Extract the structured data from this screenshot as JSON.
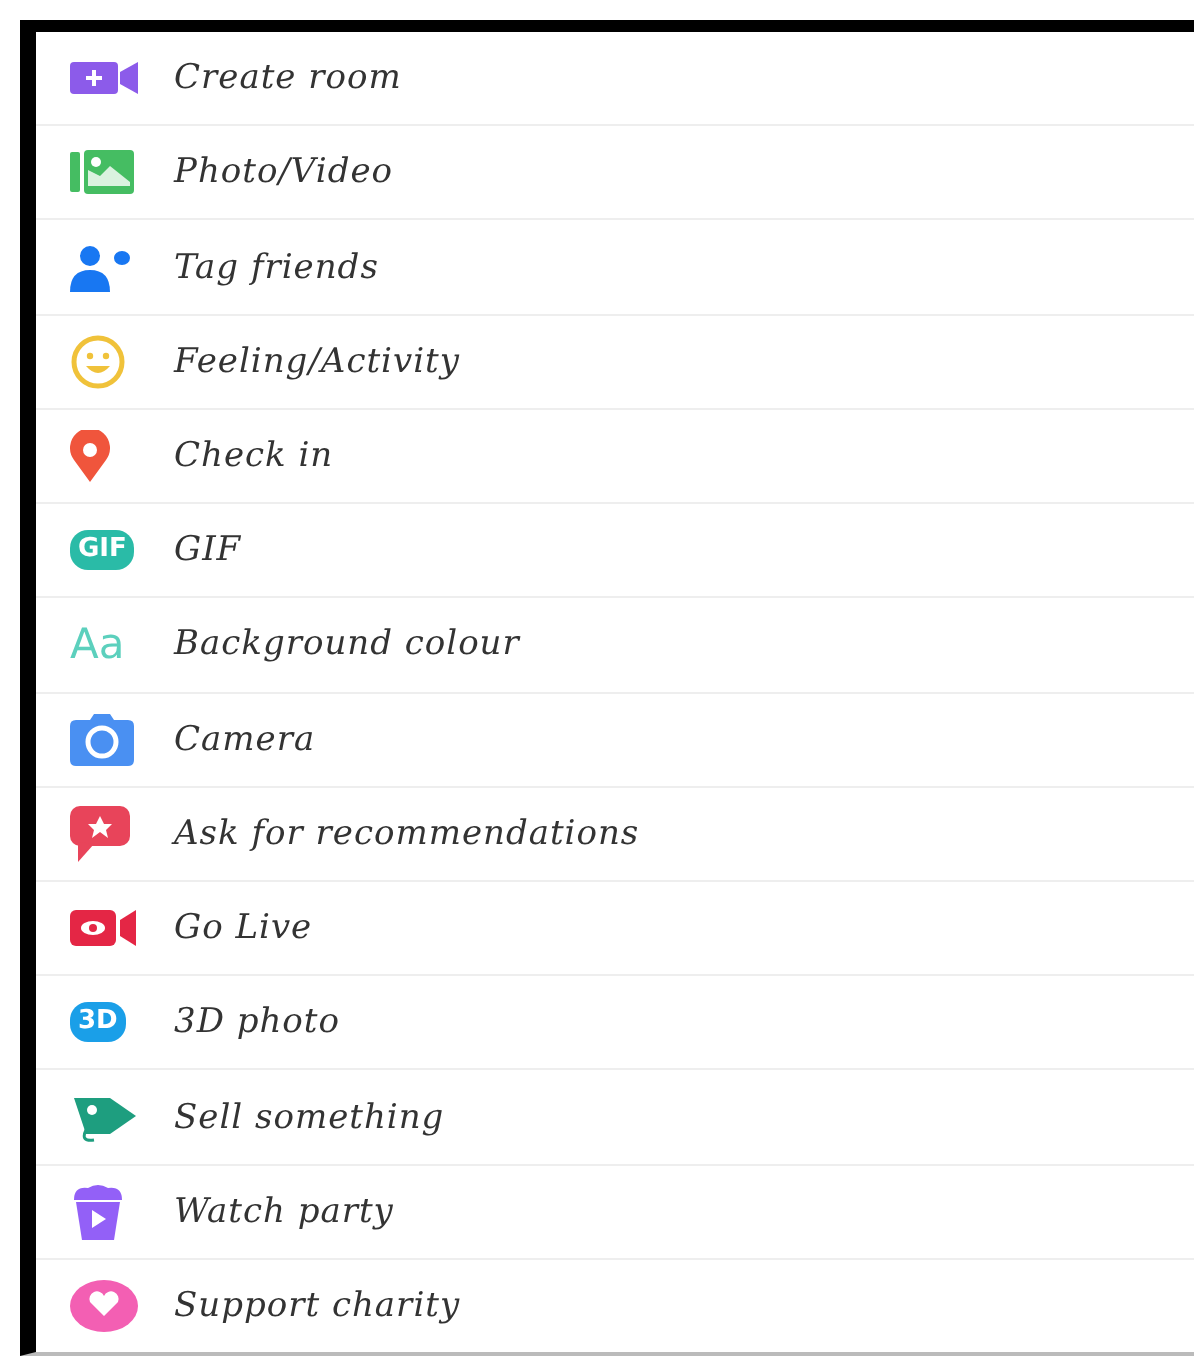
{
  "items": [
    {
      "label": "Create room",
      "kind": "video-plus",
      "color": "#8c5bea"
    },
    {
      "label": "Photo/Video",
      "kind": "photo",
      "color": "#45bd62"
    },
    {
      "label": "Tag friends",
      "kind": "people",
      "color": "#1877f2"
    },
    {
      "label": "Feeling/Activity",
      "kind": "smiley",
      "color": "#f0c23a"
    },
    {
      "label": "Check in",
      "kind": "pin",
      "color": "#f0553c"
    },
    {
      "label": "GIF",
      "kind": "badge",
      "icon_text": "GIF",
      "color": "#2abba7"
    },
    {
      "label": "Background colour",
      "kind": "letters",
      "icon_text": "Aa",
      "color": "#5cd0bd"
    },
    {
      "label": "Camera",
      "kind": "camera",
      "color": "#4a90f2"
    },
    {
      "label": "Ask for recommendations",
      "kind": "speech",
      "color": "#e8445a"
    },
    {
      "label": "Go Live",
      "kind": "live",
      "color": "#e42645"
    },
    {
      "label": "3D photo",
      "kind": "badge",
      "icon_text": "3D",
      "color": "#1a9fe8"
    },
    {
      "label": "Sell something",
      "kind": "tag",
      "color": "#1e9e7f"
    },
    {
      "label": "Watch party",
      "kind": "popcorn",
      "color": "#9360f7"
    },
    {
      "label": "Support charity",
      "kind": "heart",
      "color": "#f35fb3"
    }
  ]
}
